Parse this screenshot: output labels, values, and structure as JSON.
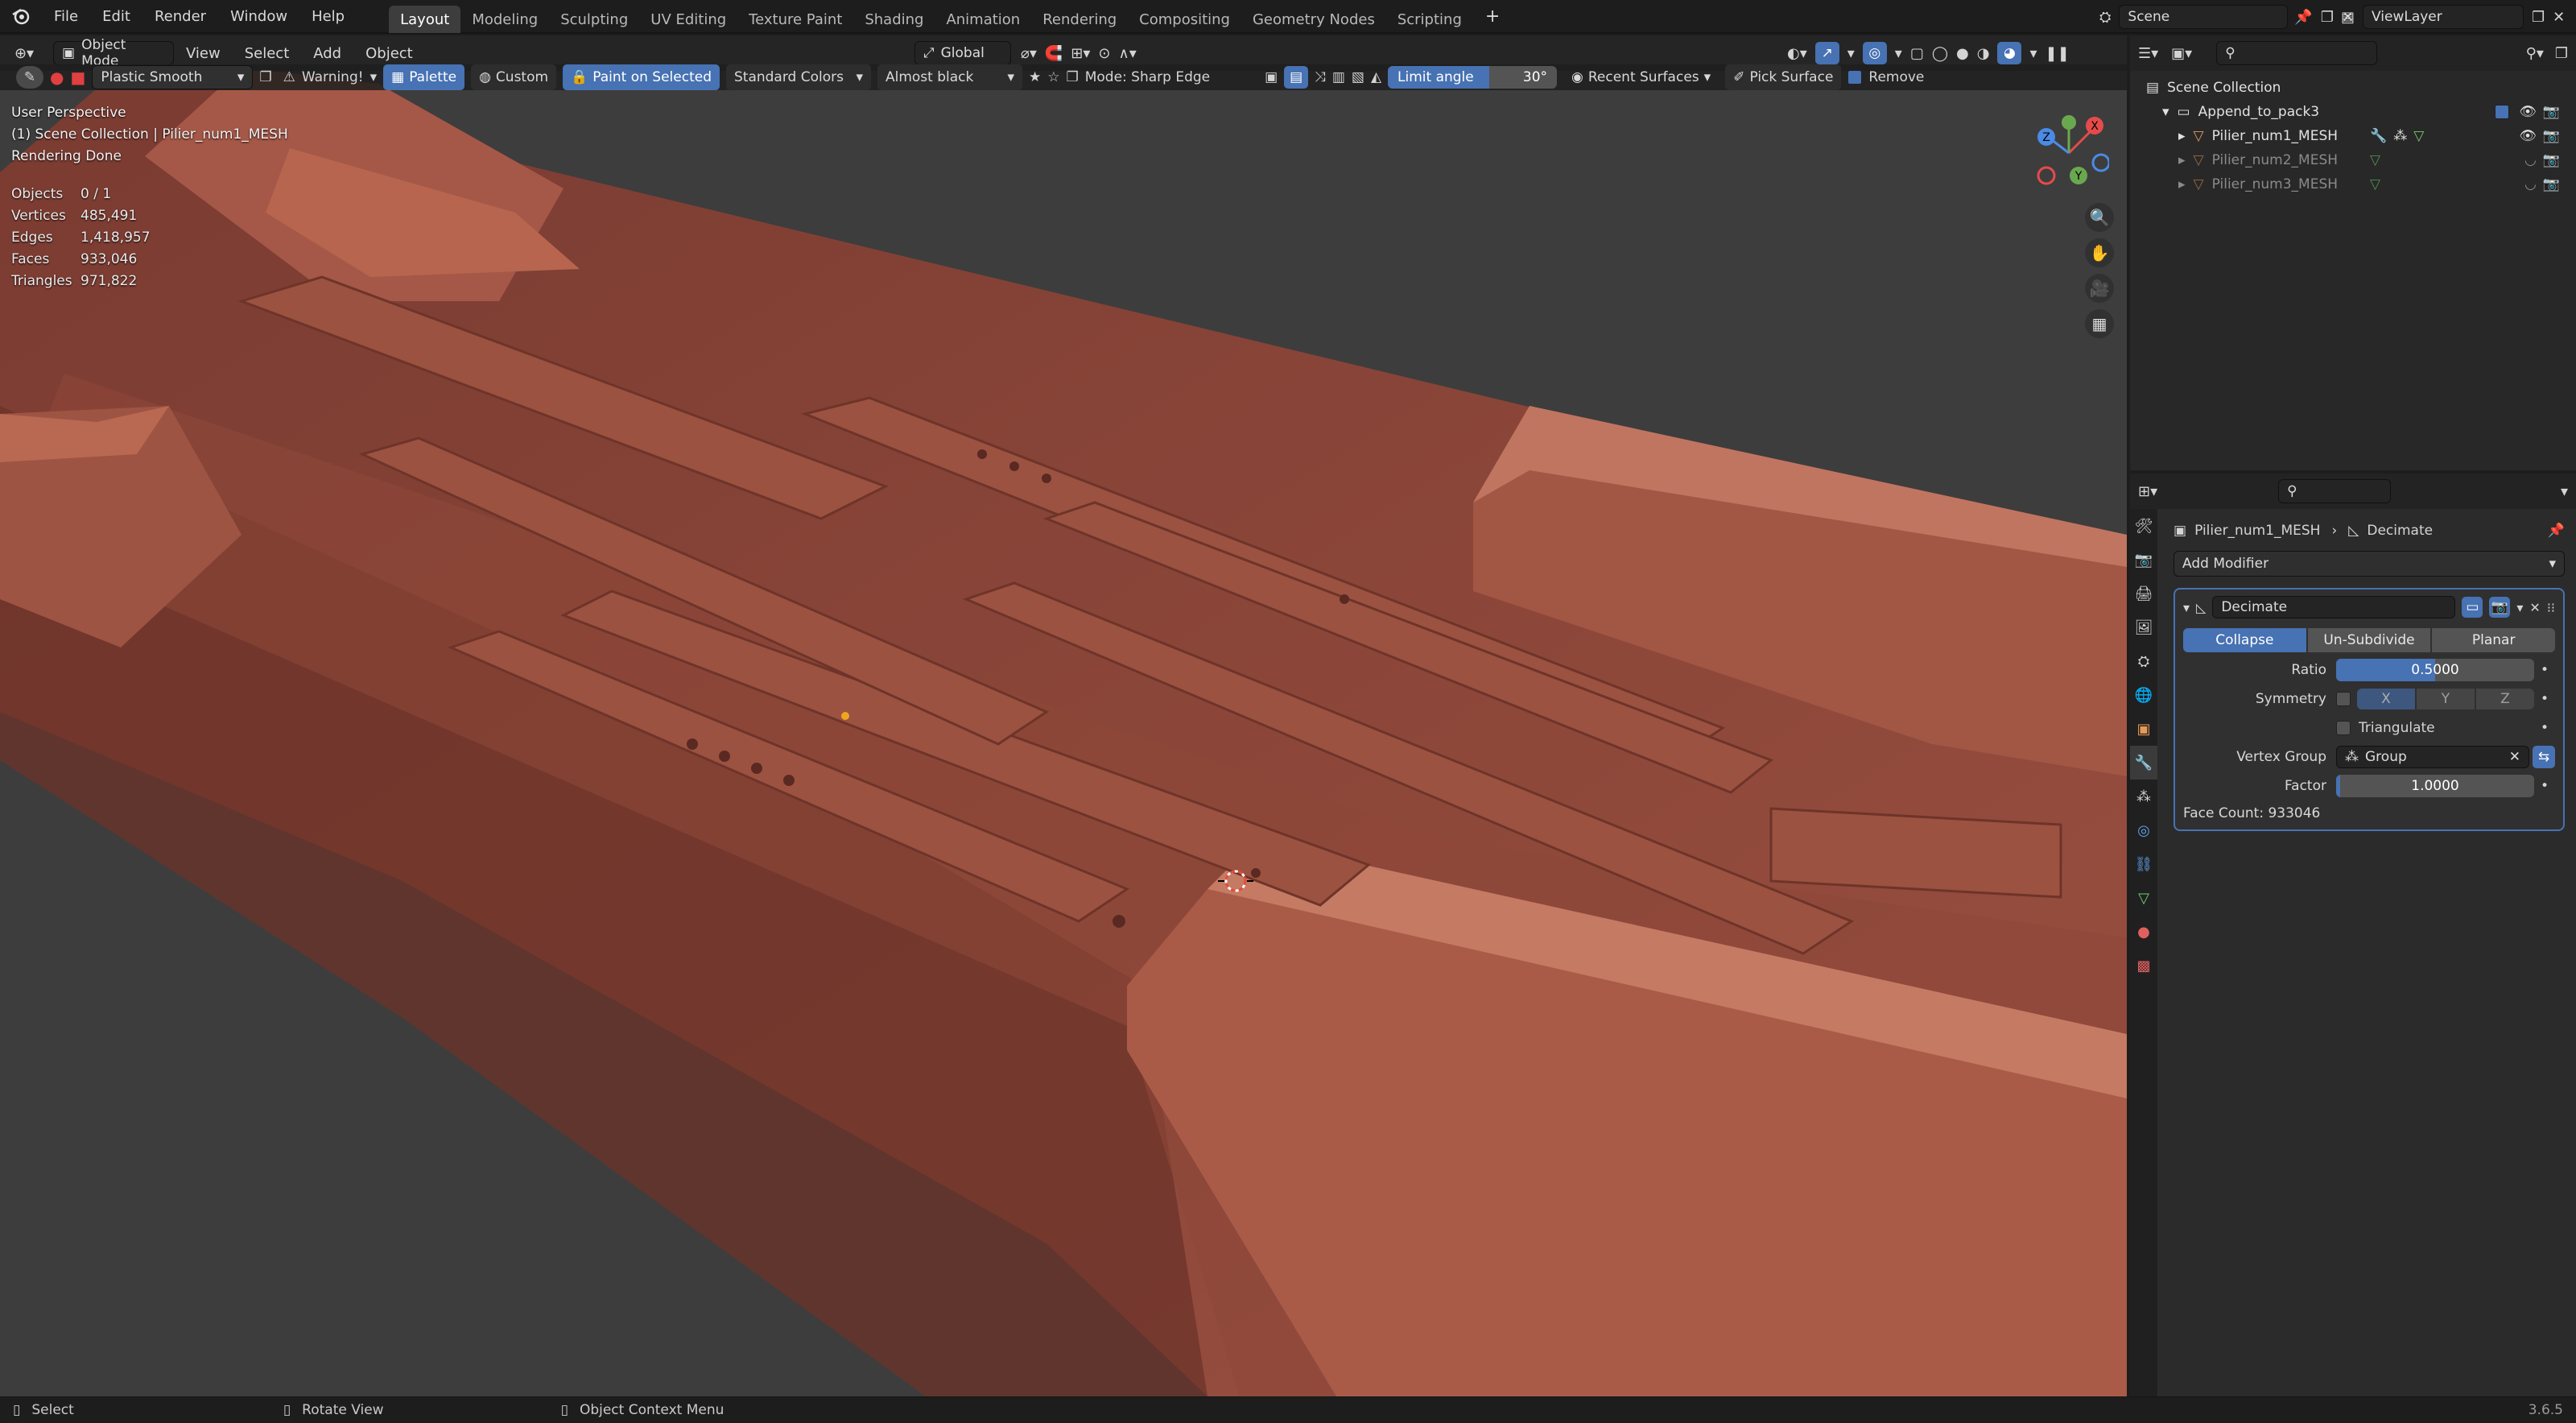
{
  "app": {
    "version": "3.6.5"
  },
  "menu": [
    "File",
    "Edit",
    "Render",
    "Window",
    "Help"
  ],
  "workspaces": [
    "Layout",
    "Modeling",
    "Sculpting",
    "UV Editing",
    "Texture Paint",
    "Shading",
    "Animation",
    "Rendering",
    "Compositing",
    "Geometry Nodes",
    "Scripting"
  ],
  "workspace_active": "Layout",
  "scene": {
    "name": "Scene",
    "view_layer": "ViewLayer"
  },
  "viewport_header": {
    "mode": "Object Mode",
    "menus": [
      "View",
      "Select",
      "Add",
      "Object"
    ],
    "transform_orientation": "Global"
  },
  "tool_header": {
    "brush": "Plastic Smooth",
    "warning": "Warning!",
    "palette": "Palette",
    "custom": "Custom",
    "paint_on_selected": "Paint on Selected",
    "color_set": "Standard Colors",
    "color": "Almost black",
    "mode": "Mode: Sharp Edge",
    "limit_angle_label": "Limit angle",
    "limit_angle_value": "30°",
    "recent_surfaces": "Recent Surfaces",
    "pick_surface": "Pick Surface",
    "remove": "Remove"
  },
  "overlay": {
    "perspective": "User Perspective",
    "collection": "(1) Scene Collection | Pilier_num1_MESH",
    "render_status": "Rendering Done",
    "stats": [
      {
        "k": "Objects",
        "v": "0 / 1"
      },
      {
        "k": "Vertices",
        "v": "485,491"
      },
      {
        "k": "Edges",
        "v": "1,418,957"
      },
      {
        "k": "Faces",
        "v": "933,046"
      },
      {
        "k": "Triangles",
        "v": "971,822"
      }
    ]
  },
  "gizmo": {
    "x": "X",
    "y": "Y",
    "z": "Z"
  },
  "outliner": {
    "root": "Scene Collection",
    "collection": "Append_to_pack3",
    "objects": [
      {
        "name": "Pilier_num1_MESH",
        "active": true
      },
      {
        "name": "Pilier_num2_MESH",
        "active": false
      },
      {
        "name": "Pilier_num3_MESH",
        "active": false
      }
    ]
  },
  "properties": {
    "object": "Pilier_num1_MESH",
    "context": "Decimate",
    "add_modifier": "Add Modifier",
    "modifier": {
      "name": "Decimate",
      "modes": [
        "Collapse",
        "Un-Subdivide",
        "Planar"
      ],
      "mode_active": "Collapse",
      "ratio_label": "Ratio",
      "ratio": "0.5000",
      "ratio_fraction": 0.5,
      "symmetry_label": "Symmetry",
      "axes": [
        "X",
        "Y",
        "Z"
      ],
      "triangulate": "Triangulate",
      "vertex_group_label": "Vertex Group",
      "vertex_group": "Group",
      "factor_label": "Factor",
      "factor": "1.0000",
      "factor_fraction": 0.02,
      "face_count": "Face Count: 933046"
    }
  },
  "statusbar": {
    "select": "Select",
    "rotate": "Rotate View",
    "context_menu": "Object Context Menu"
  },
  "colors": {
    "accent": "#4772b3",
    "mesh": "#8f4a3c",
    "viewport_bg": "#3d3d3d"
  }
}
